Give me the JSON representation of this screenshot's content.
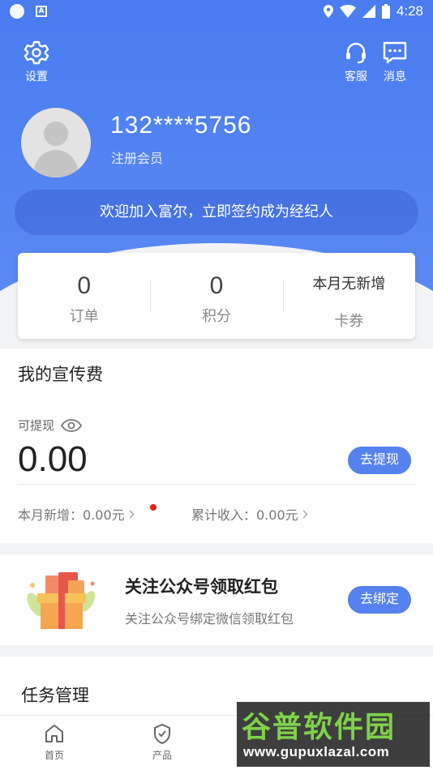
{
  "statusbar": {
    "time": "4:28"
  },
  "header": {
    "settings_label": "设置",
    "service_label": "客服",
    "messages_label": "消息",
    "phone": "132****5756",
    "member_status": "注册会员",
    "welcome_text": "欢迎加入富尔，立即签约成为经纪人"
  },
  "stats": {
    "orders": {
      "value": "0",
      "label": "订单"
    },
    "points": {
      "value": "0",
      "label": "积分"
    },
    "coupons": {
      "value": "本月无新增",
      "label": "卡券"
    }
  },
  "fee": {
    "title": "我的宣传费",
    "withdrawable_label": "可提现",
    "amount": "0.00",
    "withdraw_button": "去提现",
    "month_new": "本月新增：0.00元",
    "total_income": "累计收入：0.00元"
  },
  "follow": {
    "title": "关注公众号领取红包",
    "desc": "关注公众号绑定微信领取红包",
    "bind_button": "去绑定"
  },
  "tasks": {
    "title": "任务管理"
  },
  "bottom_nav": {
    "home": "首页",
    "products": "产品"
  },
  "watermark": {
    "main": "谷普软件园",
    "url": "www.gupuxlazal.com"
  },
  "colors": {
    "primary": "#4a7cf0",
    "button": "#5682ef",
    "red_dot": "#e02020"
  }
}
